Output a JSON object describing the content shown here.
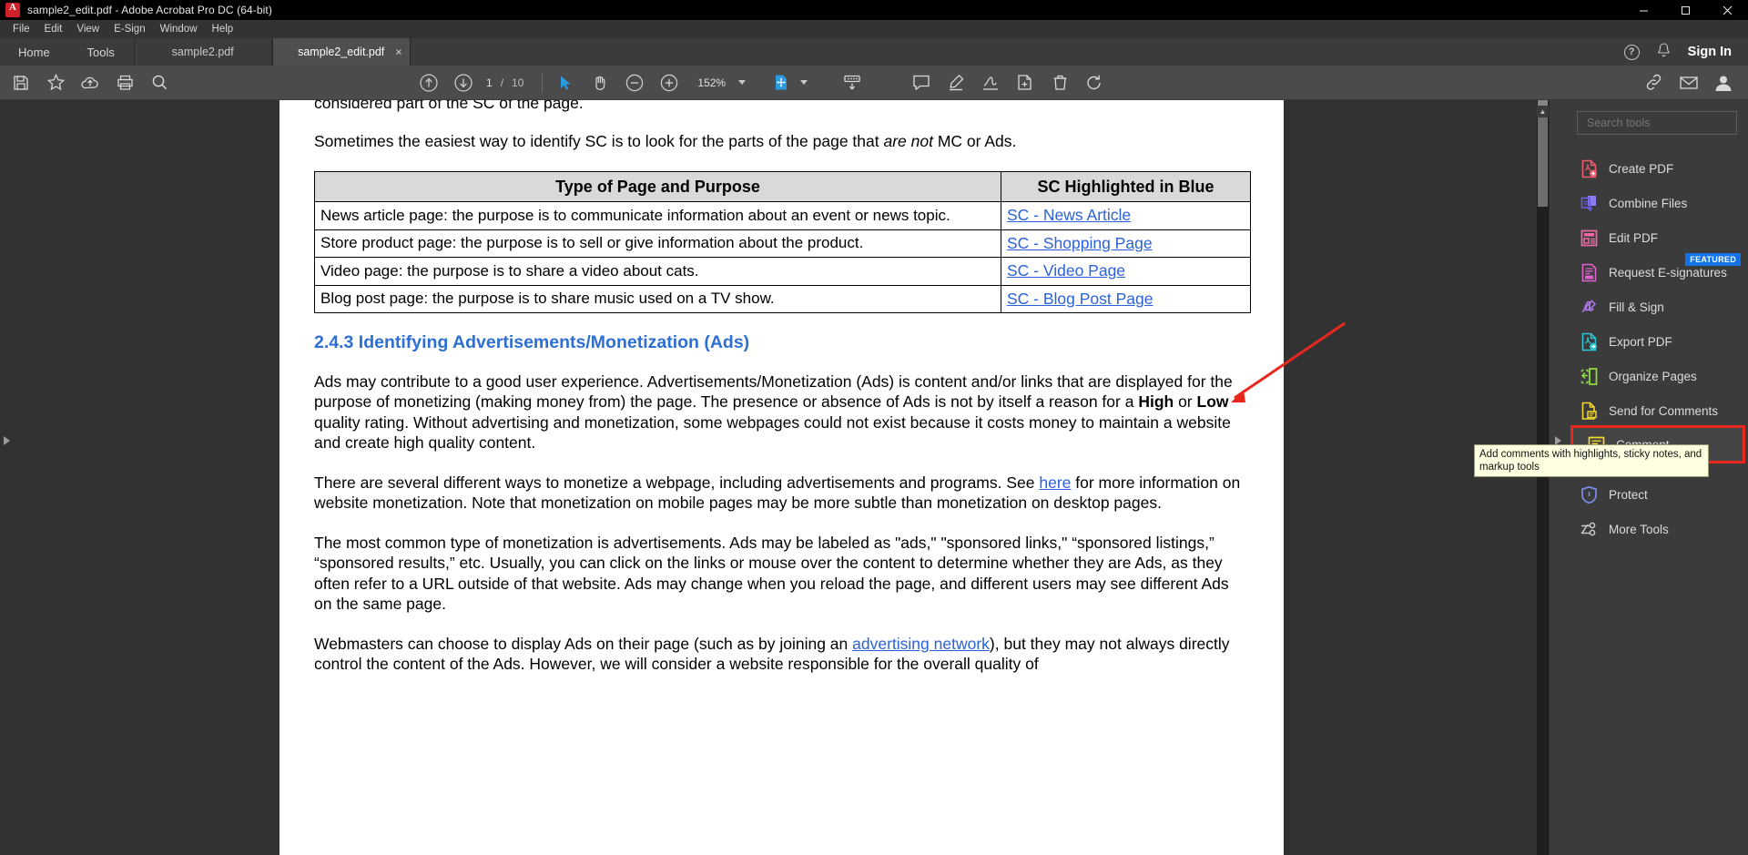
{
  "window": {
    "title": "sample2_edit.pdf - Adobe Acrobat Pro DC (64-bit)",
    "app_icon": "acrobat-logo-icon",
    "minimize": "minimize-button",
    "maximize": "maximize-button",
    "close": "close-button"
  },
  "menubar": {
    "items": [
      {
        "label": "File"
      },
      {
        "label": "Edit"
      },
      {
        "label": "View"
      },
      {
        "label": "E-Sign"
      },
      {
        "label": "Window"
      },
      {
        "label": "Help"
      }
    ]
  },
  "tabbar": {
    "home": "Home",
    "tools": "Tools",
    "documents": [
      {
        "label": "sample2.pdf",
        "active": false
      },
      {
        "label": "sample2_edit.pdf",
        "active": true,
        "close": "×"
      }
    ],
    "help_icon": "help-circle-icon",
    "bell_icon": "notification-bell-icon",
    "signin": "Sign In"
  },
  "toolbar": {
    "save_icon": "save-icon",
    "star_icon": "add-to-favorites-star-icon",
    "cloud_icon": "upload-to-cloud-icon",
    "print_icon": "print-icon",
    "search_icon": "search-magnifier-icon",
    "prev_page_icon": "previous-page-arrow-icon",
    "next_page_icon": "next-page-arrow-icon",
    "page_current": "1",
    "page_sep": "/",
    "page_total": "10",
    "select_tool_icon": "select-cursor-icon",
    "hand_tool_icon": "hand-pan-icon",
    "zoom_out_icon": "zoom-out-icon",
    "zoom_in_icon": "zoom-in-icon",
    "zoom_value": "152%",
    "zoom_dropdown_icon": "chevron-down-icon",
    "fit_page_icon": "fit-page-icon",
    "fit_dropdown_icon": "chevron-down-icon",
    "scroll_mode_icon": "page-scrolling-icon",
    "comment_icon": "add-comment-icon",
    "highlight_icon": "highlight-marker-icon",
    "fillsign_icon": "fill-and-sign-icon",
    "stamp_icon": "add-stamp-icon",
    "delete_icon": "delete-trash-icon",
    "rotate_icon": "rotate-page-icon",
    "share_link_icon": "share-link-icon",
    "email_icon": "email-icon",
    "account_icon": "user-account-icon"
  },
  "document": {
    "cut_top_line": "considered part of the SC of the page.",
    "para_1_a": "Sometimes the easiest way to identify SC is to look for the parts of the page that ",
    "para_1_italic": "are not",
    "para_1_b": " MC or Ads.",
    "table": {
      "headers": [
        "Type of Page and Purpose",
        "SC Highlighted in Blue"
      ],
      "rows": [
        {
          "purpose": "News article page: the purpose is to communicate information about an event or news topic.",
          "link": "SC - News Article"
        },
        {
          "purpose": "Store product page: the purpose is to sell or give information about the product.",
          "link": "SC - Shopping Page"
        },
        {
          "purpose": "Video page: the purpose is to share a video about cats.",
          "link": "SC - Video Page"
        },
        {
          "purpose": "Blog post page: the purpose is to share music used on a TV show.",
          "link": "SC - Blog Post Page"
        }
      ]
    },
    "heading": "2.4.3 Identifying Advertisements/Monetization (Ads)",
    "para_2_a": "Ads may contribute to a good user experience.  Advertisements/Monetization (Ads) is content and/or links that are displayed for the purpose of monetizing (making money from) the page.  The presence or absence of Ads is not by itself a reason for a ",
    "para_2_high": "High",
    "para_2_b": " or ",
    "para_2_low": "Low",
    "para_2_c": " quality rating.  Without advertising and monetization, some webpages could not exist because it costs money to maintain a website and create high quality content.",
    "para_3_a": "There are several different ways to monetize a webpage, including advertisements and programs.  See ",
    "para_3_link": "here",
    "para_3_b": " for more information on website monetization.  Note that monetization on mobile pages may be more subtle than monetization on desktop pages.",
    "para_4": "The most common type of monetization is advertisements.  Ads may be labeled as \"ads,\" \"sponsored links,\" “sponsored listings,” “sponsored results,” etc.  Usually, you can click on the links or mouse over the content to determine whether they are Ads, as they often refer to a URL outside of that website.  Ads may change when you reload the page, and different users may see different Ads on the same page.",
    "para_5_a": "Webmasters can choose to display Ads on their page (such as by joining an ",
    "para_5_link": "advertising network",
    "para_5_b": "), but they may not always directly control the content of the Ads.  However, we will consider a website responsible for the overall quality of"
  },
  "tools_sidebar": {
    "search_placeholder": "Search tools",
    "items": [
      {
        "label": "Create PDF",
        "icon": "create-pdf-icon",
        "color": "#ef5b6b",
        "badge": null,
        "highlighted": false
      },
      {
        "label": "Combine Files",
        "icon": "combine-files-icon",
        "color": "#7b68ee",
        "badge": null,
        "highlighted": false
      },
      {
        "label": "Edit PDF",
        "icon": "edit-pdf-icon",
        "color": "#f06ba8",
        "badge": null,
        "highlighted": false
      },
      {
        "label": "Request E-signatures",
        "icon": "request-esignatures-icon",
        "color": "#e062d0",
        "badge": "FEATURED",
        "highlighted": false
      },
      {
        "label": "Fill & Sign",
        "icon": "fill-and-sign-icon",
        "color": "#b07bf0",
        "badge": null,
        "highlighted": false
      },
      {
        "label": "Export PDF",
        "icon": "export-pdf-icon",
        "color": "#2ec5d3",
        "badge": null,
        "highlighted": false
      },
      {
        "label": "Organize Pages",
        "icon": "organize-pages-icon",
        "color": "#8ee33f",
        "badge": null,
        "highlighted": false
      },
      {
        "label": "Send for Comments",
        "icon": "send-for-comments-icon",
        "color": "#f2d733",
        "badge": null,
        "highlighted": false
      },
      {
        "label": "Comment",
        "icon": "comment-icon",
        "color": "#f2d733",
        "badge": null,
        "highlighted": true
      }
    ],
    "items_bottom": [
      {
        "label": "Protect",
        "icon": "protect-shield-icon",
        "color": "#7b8ef0"
      },
      {
        "label": "More Tools",
        "icon": "more-tools-icon",
        "color": "#c9c9c9"
      }
    ],
    "tooltip": "Add comments with highlights, sticky notes, and markup tools"
  },
  "annotations": {
    "arrow_color": "#e8271e",
    "highlight_color": "#e8271e"
  }
}
